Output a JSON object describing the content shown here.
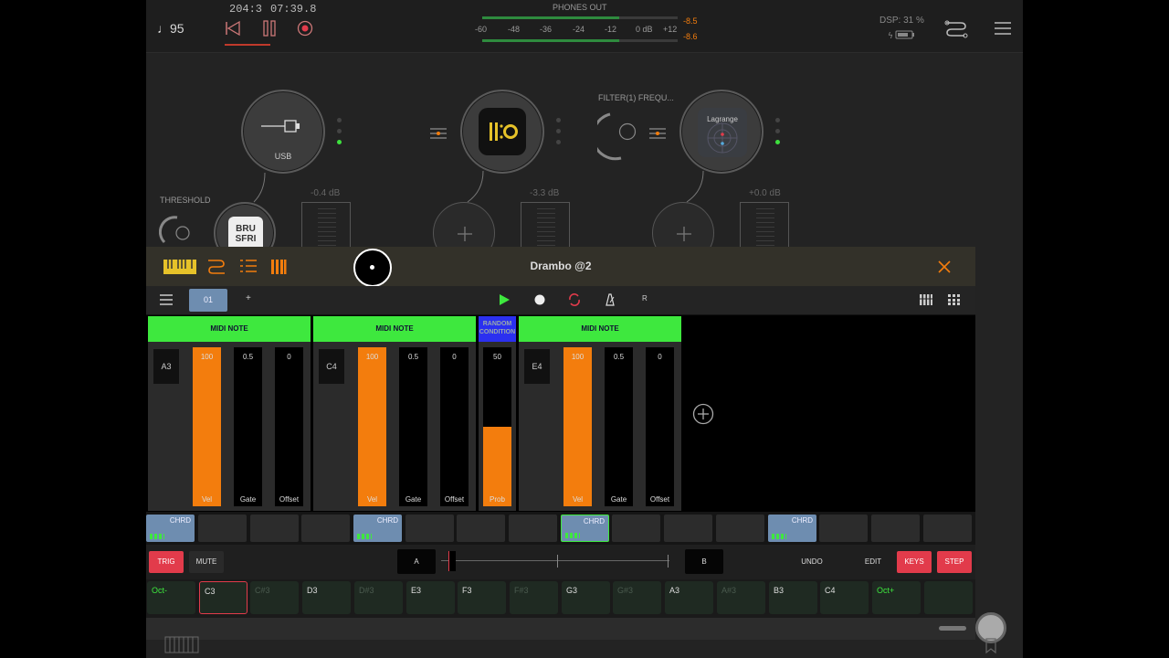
{
  "topbar": {
    "tempo": "♩95",
    "position": "204:3",
    "time": "07:39.8",
    "phones_label": "PHONES OUT",
    "meter_ticks": [
      "-60",
      "-48",
      "-36",
      "-24",
      "-12",
      "0 dB",
      "+12"
    ],
    "peak_left": "-8.5",
    "peak_right": "-8.6",
    "dsp": "DSP: 31 %"
  },
  "graph": {
    "node_usb_label": "USB",
    "threshold_label": "THRESHOLD",
    "fader1_db": "-0.4 dB",
    "fader2_db": "-3.3 dB",
    "fader3_db": "+0.0 dB",
    "filter_label": "FILTER(1) FREQU...",
    "lagrange_label": "Lagrange",
    "brusfri_label": "BRU SFRI"
  },
  "panel": {
    "title": "Drambo @2",
    "pattern": "01",
    "add": "+",
    "r_label": "R",
    "blocks": [
      {
        "header": "MIDI NOTE",
        "note": "A3",
        "vel": "100",
        "gate": "0.5",
        "offset": "0",
        "vel_fill": 1.0
      },
      {
        "header": "MIDI NOTE",
        "note": "C4",
        "vel": "100",
        "gate": "0.5",
        "offset": "0",
        "vel_fill": 1.0
      },
      {
        "header": "MIDI NOTE",
        "note": "E4",
        "vel": "100",
        "gate": "0.5",
        "offset": "0",
        "vel_fill": 1.0
      }
    ],
    "random_header": "RANDOM CONDITION",
    "prob_value": "50",
    "prob_fill": 0.5,
    "labels": {
      "vel": "Vel",
      "gate": "Gate",
      "offset": "Offset",
      "prob": "Prob"
    },
    "chrd": "CHRD",
    "ctrl": {
      "trig": "TRIG",
      "mute": "MUTE",
      "a": "A",
      "b": "B",
      "undo": "UNDO",
      "edit": "EDIT",
      "keys": "KEYS",
      "step": "STEP"
    },
    "keys": [
      "Oct-",
      "C3",
      "C#3",
      "D3",
      "D#3",
      "E3",
      "F3",
      "F#3",
      "G3",
      "G#3",
      "A3",
      "A#3",
      "B3",
      "C4",
      "Oct+",
      ""
    ]
  },
  "colors": {
    "accent_green": "#3ee83e",
    "accent_orange": "#f37d0d",
    "accent_red": "#e23b4b",
    "chord_blue": "#6e8db0"
  }
}
